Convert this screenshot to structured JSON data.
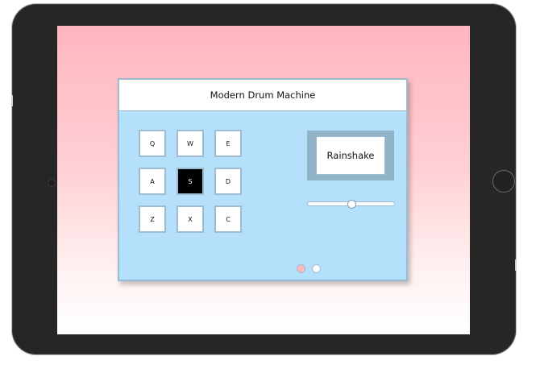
{
  "machine": {
    "title": "Modern Drum Machine",
    "pads": [
      {
        "key": "Q",
        "active": false
      },
      {
        "key": "W",
        "active": false
      },
      {
        "key": "E",
        "active": false
      },
      {
        "key": "A",
        "active": false
      },
      {
        "key": "S",
        "active": true
      },
      {
        "key": "D",
        "active": false
      },
      {
        "key": "Z",
        "active": false
      },
      {
        "key": "X",
        "active": false
      },
      {
        "key": "C",
        "active": false
      }
    ],
    "display_text": "Rainshake",
    "volume": 0.5,
    "toggles": [
      {
        "name": "power-toggle",
        "color": "#ffb6be",
        "on": true
      },
      {
        "name": "bank-toggle",
        "color": "#ffffff",
        "on": false
      }
    ]
  },
  "colors": {
    "machine_bg": "#b4e0fb",
    "border": "#9dbcd2",
    "active_pad": "#000000",
    "device_frame": "#262626"
  }
}
